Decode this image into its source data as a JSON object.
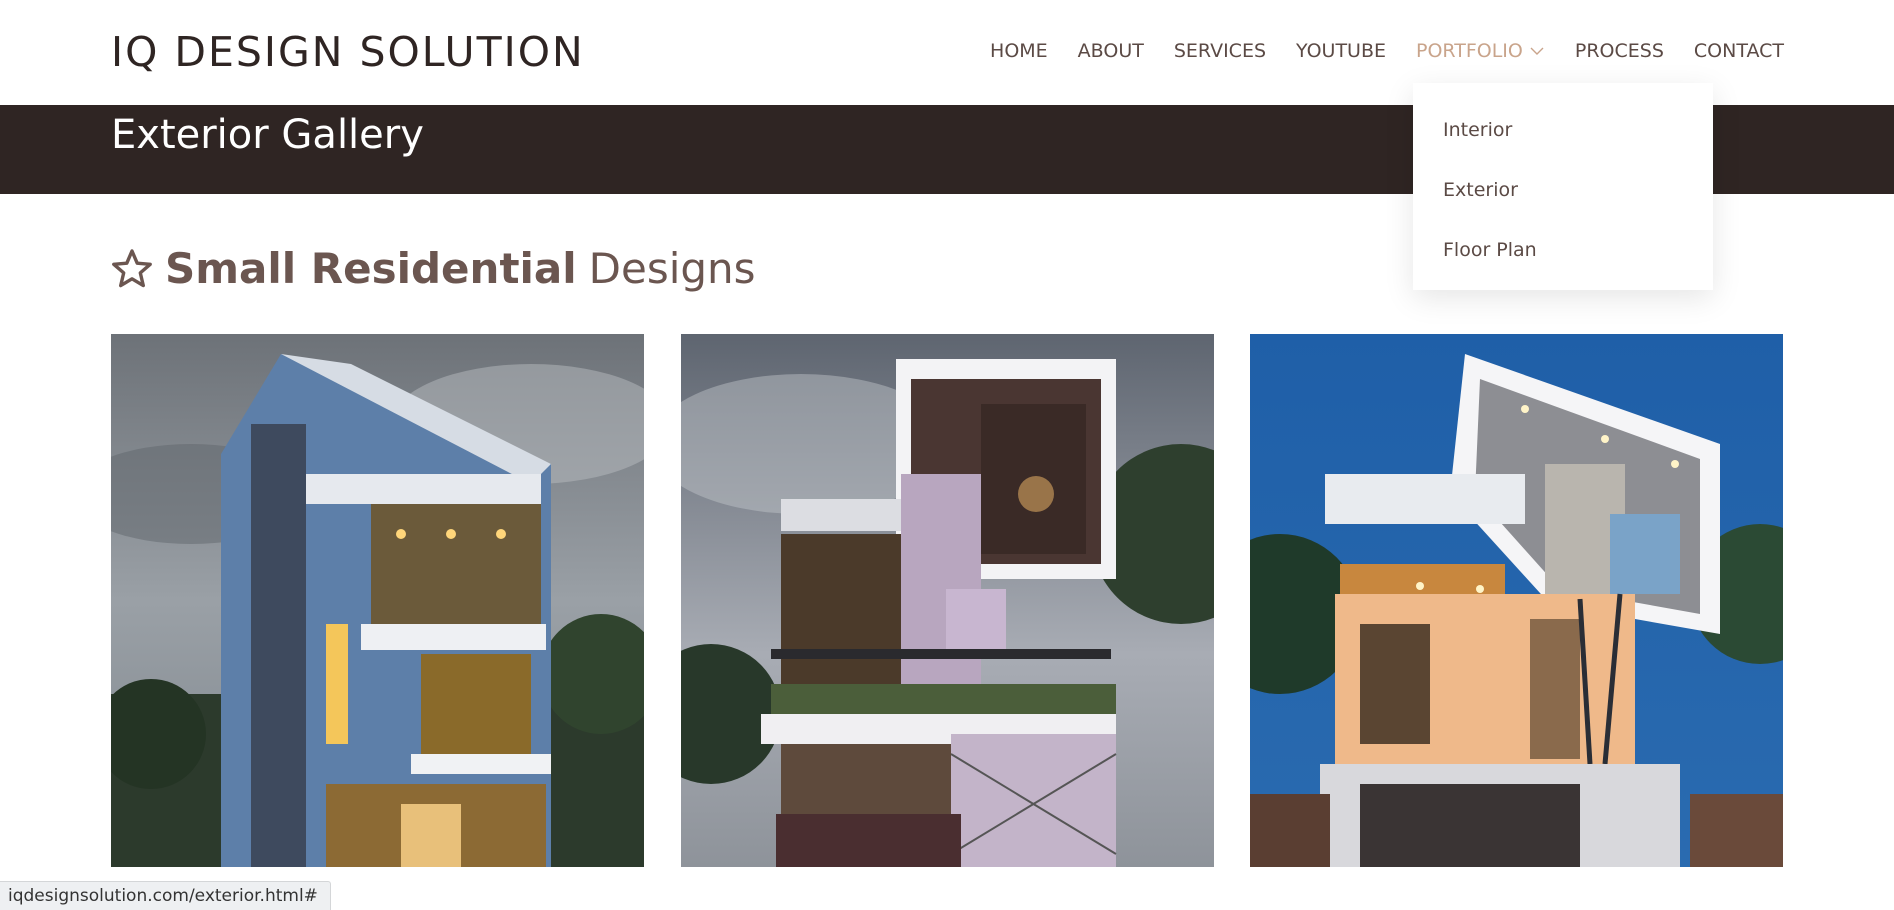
{
  "header": {
    "logo": "IQ DESIGN SOLUTION",
    "nav": [
      {
        "label": "HOME"
      },
      {
        "label": "ABOUT"
      },
      {
        "label": "SERVICES"
      },
      {
        "label": "YOUTUBE"
      },
      {
        "label": "PORTFOLIO",
        "active": true
      },
      {
        "label": "PROCESS"
      },
      {
        "label": "CONTACT"
      }
    ]
  },
  "portfolio_dropdown": {
    "items": [
      {
        "label": "Interior"
      },
      {
        "label": "Exterior"
      },
      {
        "label": "Floor Plan"
      }
    ]
  },
  "title_band": {
    "title": "Exterior Gallery"
  },
  "section": {
    "icon": "star-icon",
    "heading_strong": "Small Residential",
    "heading_light": "Designs"
  },
  "gallery": {
    "images": [
      {
        "name": "house-render-1"
      },
      {
        "name": "house-render-2"
      },
      {
        "name": "house-render-3"
      }
    ]
  },
  "status_bar": {
    "url": "iqdesignsolution.com/exterior.html#"
  },
  "colors": {
    "brand_dark": "#2f2523",
    "nav_text": "#5b4a45",
    "nav_active": "#c9a48b",
    "heading": "#6b5650"
  }
}
